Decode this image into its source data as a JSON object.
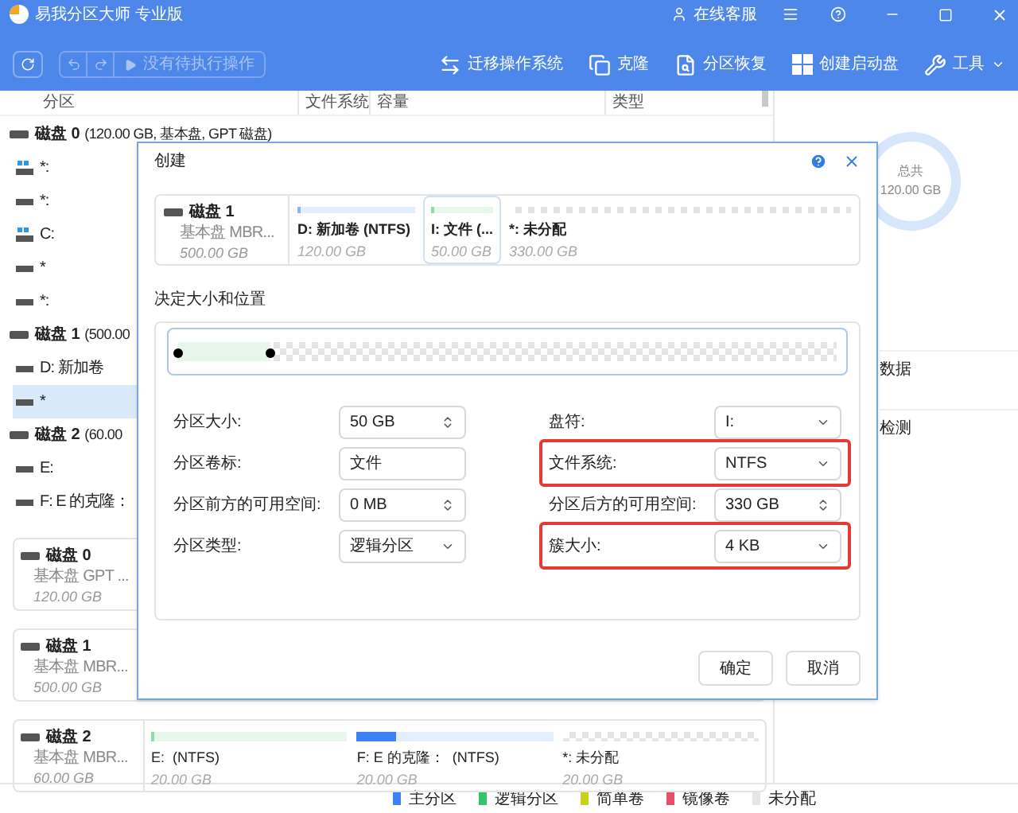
{
  "window": {
    "title": "易我分区大师 专业版",
    "support": "在线客服"
  },
  "toolbar": {
    "pending": "没有待执行操作",
    "actions": [
      {
        "label": "迁移操作系统",
        "kind": "migrate"
      },
      {
        "label": "克隆",
        "kind": "clone"
      },
      {
        "label": "分区恢复",
        "kind": "recover"
      },
      {
        "label": "创建启动盘",
        "kind": "boot"
      },
      {
        "label": "工具",
        "kind": "tools"
      }
    ]
  },
  "columns": [
    "分区",
    "文件系统",
    "容量",
    "类型"
  ],
  "tree": [
    {
      "label": "磁盘 0",
      "detail": "(120.00 GB, 基本盘, GPT 磁盘)",
      "children": [
        {
          "label": "*:",
          "kind": "system",
          "selected": false
        },
        {
          "label": "*:",
          "kind": "plain",
          "selected": false
        },
        {
          "label": "C:",
          "kind": "system",
          "selected": false
        },
        {
          "label": "*",
          "kind": "plain",
          "selected": false
        },
        {
          "label": "*:",
          "kind": "plain",
          "selected": false
        }
      ]
    },
    {
      "label": "磁盘 1",
      "detail": "(500.00",
      "children": [
        {
          "label": "D: 新加卷",
          "kind": "plain",
          "selected": false
        },
        {
          "label": "*",
          "kind": "plain",
          "selected": true
        }
      ]
    },
    {
      "label": "磁盘 2",
      "detail": "(60.00",
      "children": [
        {
          "label": "E:",
          "kind": "plain",
          "selected": false
        },
        {
          "label": "F: E 的克隆：",
          "kind": "plain",
          "selected": false
        }
      ]
    }
  ],
  "disk_cards": [
    {
      "name": "磁盘 0",
      "type": "基本盘 GPT ...",
      "size": "120.00 GB"
    },
    {
      "name": "磁盘 1",
      "type": "基本盘 MBR...",
      "size": "500.00 GB"
    },
    {
      "name": "磁盘 2",
      "type": "基本盘 MBR...",
      "size": "60.00 GB",
      "partitions": [
        {
          "label": "E:  (NTFS)",
          "size": "20.00 GB",
          "kind": "logical"
        },
        {
          "label": "F: E 的克隆：  (NTFS)",
          "size": "20.00 GB",
          "kind": "primary",
          "level": 0.2
        },
        {
          "label": "*: 未分配",
          "size": "20.00 GB",
          "kind": "unallocated"
        }
      ]
    }
  ],
  "side_panel": {
    "total_label": "总共",
    "total": "120.00 GB",
    "items": [
      "数据",
      "检测"
    ]
  },
  "legend": [
    {
      "label": "主分区",
      "color": "#3b82f6"
    },
    {
      "label": "逻辑分区",
      "color": "#34c56b"
    },
    {
      "label": "简单卷",
      "color": "#c8d21a"
    },
    {
      "label": "镜像卷",
      "color": "#e8506a"
    },
    {
      "label": "未分配",
      "color": "#e6e6e6"
    }
  ],
  "dialog": {
    "title": "创建",
    "disk": {
      "name": "磁盘 1",
      "type": "基本盘 MBR...",
      "size": "500.00 GB"
    },
    "partitions": [
      {
        "label": "D: 新加卷 (NTFS)",
        "size": "120.00 GB",
        "kind": "primary",
        "selected": false
      },
      {
        "label": "I: 文件 (...",
        "size": "50.00 GB",
        "kind": "logical",
        "selected": true
      },
      {
        "label": "*: 未分配",
        "size": "330.00 GB",
        "kind": "unallocated",
        "selected": false
      }
    ],
    "section": "决定大小和位置",
    "slider": {
      "level": 0.14
    },
    "left_fields": [
      {
        "label": "分区大小:",
        "value": "50 GB",
        "kind": "spin",
        "highlighted": false
      },
      {
        "label": "分区卷标:",
        "value": "文件",
        "kind": "text",
        "highlighted": false
      },
      {
        "label": "分区前方的可用空间:",
        "value": "0 MB",
        "kind": "spin",
        "highlighted": false
      },
      {
        "label": "分区类型:",
        "value": "逻辑分区",
        "kind": "select",
        "highlighted": false
      }
    ],
    "right_fields": [
      {
        "label": "盘符:",
        "value": "I:",
        "kind": "select",
        "highlighted": false
      },
      {
        "label": "文件系统:",
        "value": "NTFS",
        "kind": "select",
        "highlighted": true
      },
      {
        "label": "分区后方的可用空间:",
        "value": "330 GB",
        "kind": "spin",
        "highlighted": false
      },
      {
        "label": "簇大小:",
        "value": "4 KB",
        "kind": "select",
        "highlighted": true
      }
    ],
    "buttons": [
      "确定",
      "取消"
    ]
  }
}
